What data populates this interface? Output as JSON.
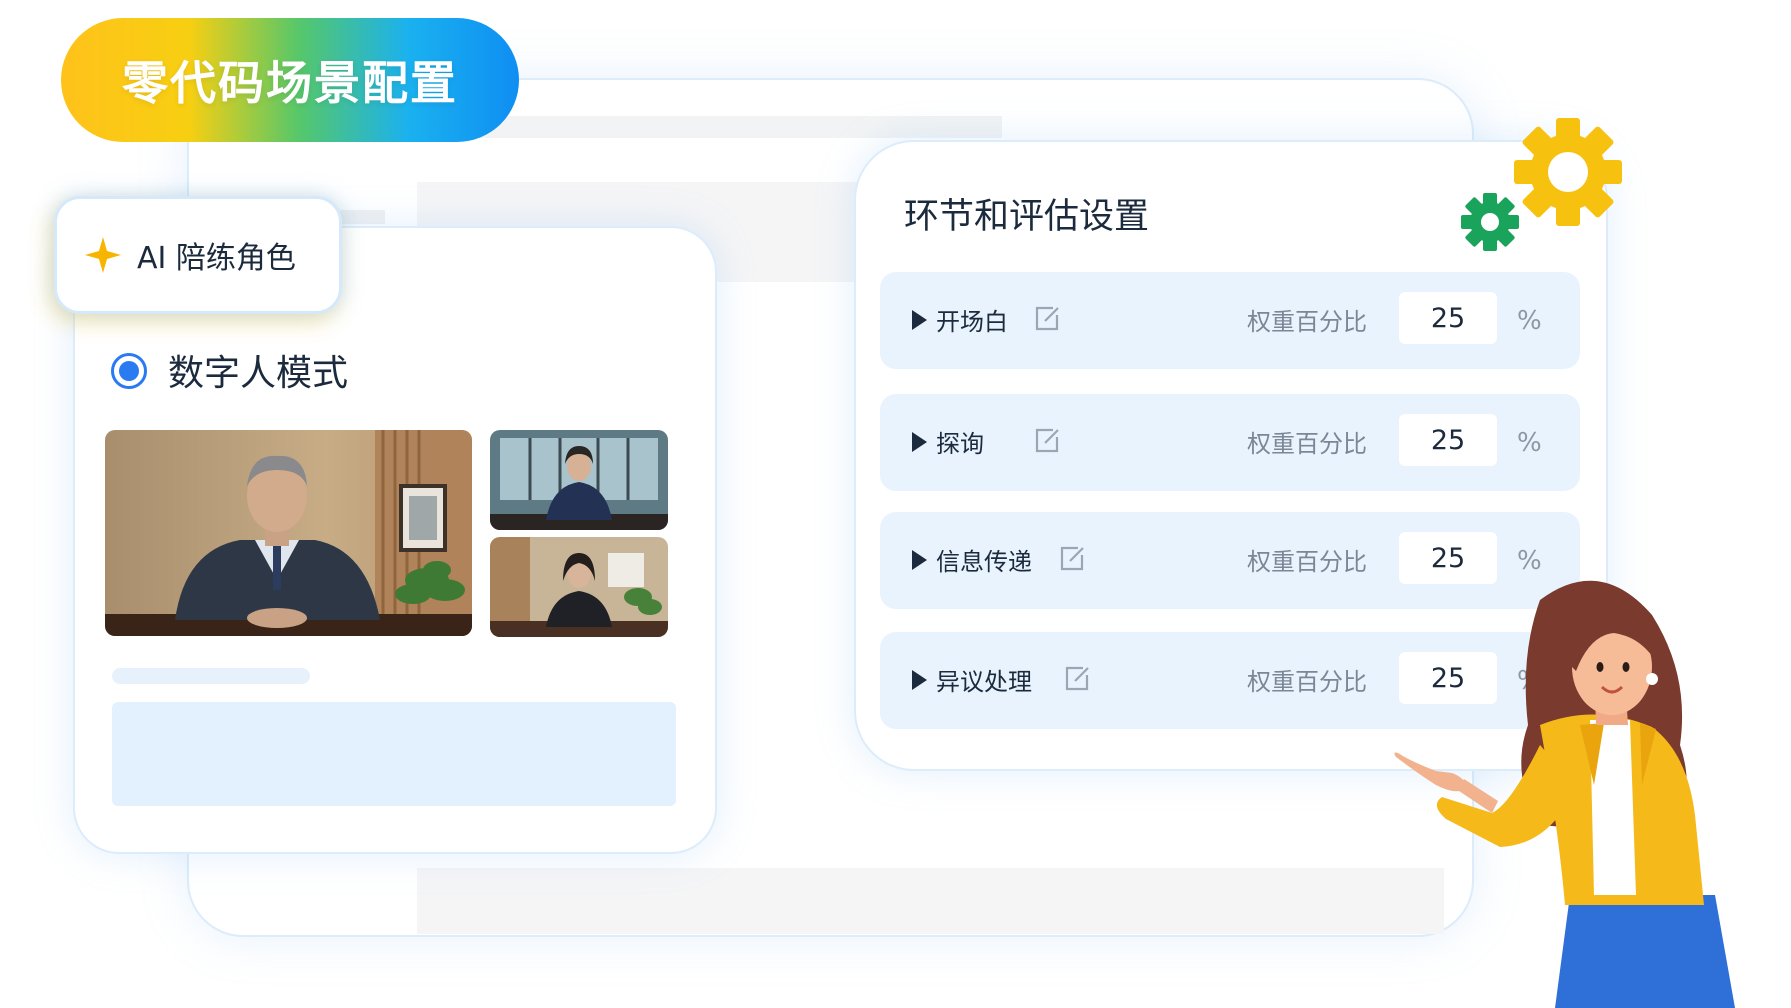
{
  "banner": {
    "title": "零代码场景配置"
  },
  "ai_role": {
    "label": "AI 陪练角色",
    "icon": "sparkle-icon",
    "accent": "#f7b500"
  },
  "mode": {
    "label": "数字人模式",
    "selected": true,
    "accent": "#2a7af2"
  },
  "avatars": [
    {
      "name": "avatar-man"
    },
    {
      "name": "avatar-woman-1"
    },
    {
      "name": "avatar-woman-2"
    }
  ],
  "settings": {
    "title": "环节和评估设置",
    "weight_label": "权重百分比",
    "percent_symbol": "%",
    "stages": [
      {
        "name": "开场白",
        "weight": "25"
      },
      {
        "name": "探询",
        "weight": "25"
      },
      {
        "name": "信息传递",
        "weight": "25"
      },
      {
        "name": "异议处理",
        "weight": "25"
      }
    ]
  },
  "colors": {
    "gear_large": "#f7c10f",
    "gear_small": "#1aa35a",
    "card_border": "#dcecfb",
    "row_bg": "#e9f3fe"
  }
}
